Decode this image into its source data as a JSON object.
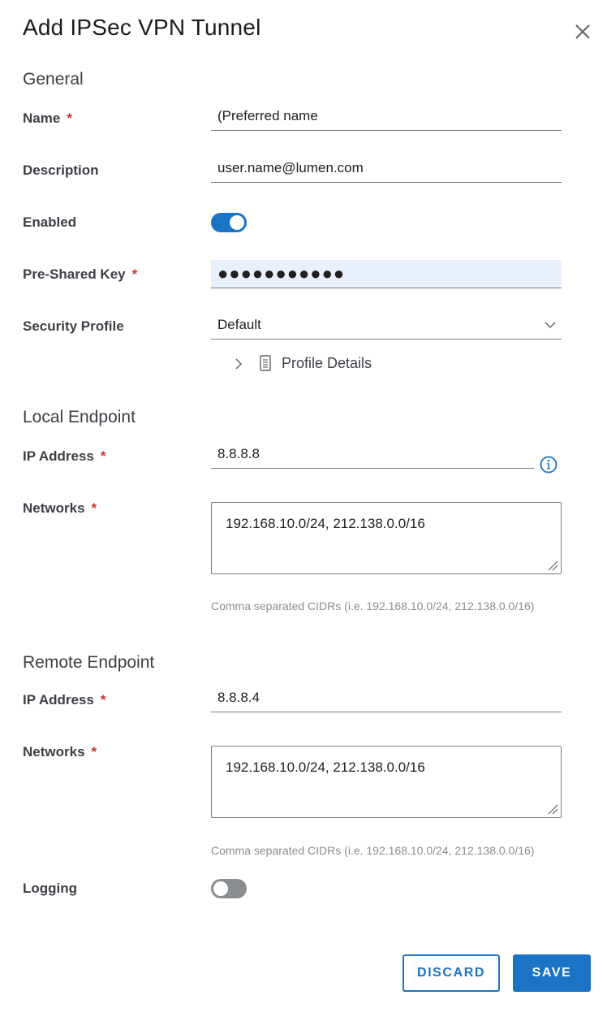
{
  "dialog": {
    "title": "Add IPSec VPN Tunnel"
  },
  "general": {
    "heading": "General",
    "name": {
      "label": "Name",
      "required": "*",
      "value": "(Preferred name"
    },
    "description": {
      "label": "Description",
      "value": "user.name@lumen.com"
    },
    "enabled": {
      "label": "Enabled",
      "state": "on"
    },
    "pre_shared_key": {
      "label": "Pre-Shared Key",
      "required": "*",
      "value": "●●●●●●●●●●●"
    },
    "security_profile": {
      "label": "Security Profile",
      "value": "Default"
    },
    "profile_details": {
      "label": "Profile Details"
    }
  },
  "local_endpoint": {
    "heading": "Local Endpoint",
    "ip_address": {
      "label": "IP Address",
      "required": "*",
      "value": "8.8.8.8"
    },
    "networks": {
      "label": "Networks",
      "required": "*",
      "value": "192.168.10.0/24, 212.138.0.0/16",
      "hint": "Comma separated CIDRs (i.e. 192.168.10.0/24, 212.138.0.0/16)"
    }
  },
  "remote_endpoint": {
    "heading": "Remote Endpoint",
    "ip_address": {
      "label": "IP Address",
      "required": "*",
      "value": "8.8.8.4"
    },
    "networks": {
      "label": "Networks",
      "required": "*",
      "value": "192.168.10.0/24, 212.138.0.0/16",
      "hint": "Comma separated CIDRs (i.e. 192.168.10.0/24, 212.138.0.0/16)"
    }
  },
  "logging": {
    "label": "Logging",
    "state": "off"
  },
  "actions": {
    "discard_label": "DISCARD",
    "save_label": "SAVE"
  },
  "colors": {
    "accent": "#1a73c4",
    "required": "#d32f2f",
    "autofill": "#e8f0fe",
    "toggle_off": "#8a8d91"
  },
  "icons": {
    "close": "close-icon",
    "chevron_down": "chevron-down-icon",
    "chevron_right": "chevron-right-icon",
    "document": "document-icon",
    "info": "info-icon",
    "resize": "resize-grip-icon"
  }
}
